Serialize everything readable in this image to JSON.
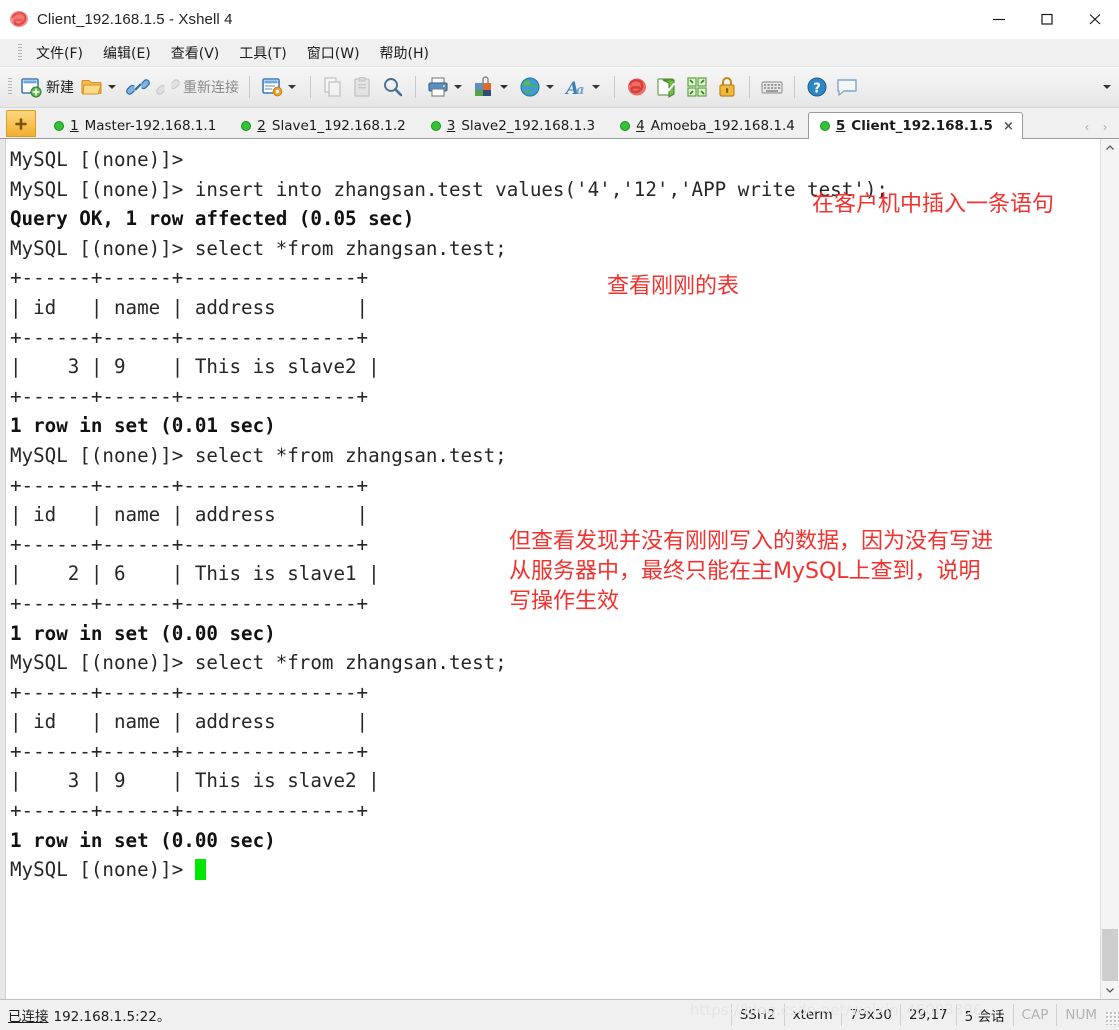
{
  "window": {
    "title": "Client_192.168.1.5 - Xshell 4",
    "app_icon": "xshell-logo-icon",
    "minimize": "—",
    "maximize": "□",
    "close": "✕"
  },
  "menubar": {
    "items": [
      {
        "label": "文件(F)",
        "name": "menu-file"
      },
      {
        "label": "编辑(E)",
        "name": "menu-edit"
      },
      {
        "label": "查看(V)",
        "name": "menu-view"
      },
      {
        "label": "工具(T)",
        "name": "menu-tools"
      },
      {
        "label": "窗口(W)",
        "name": "menu-window"
      },
      {
        "label": "帮助(H)",
        "name": "menu-help"
      }
    ]
  },
  "toolbar": {
    "new_label": "新建",
    "reconnect_label": "重新连接",
    "overflow_label": "▾",
    "icons": [
      "new-session-icon",
      "open-folder-icon",
      "connect-icon",
      "disconnect-icon",
      "session-properties-icon",
      "copy-icon",
      "paste-icon",
      "find-icon",
      "print-icon",
      "color-scheme-icon",
      "globe-icon",
      "font-icon",
      "xftp-icon",
      "transfer-icon",
      "arrange-icon",
      "lock-icon",
      "keyboard-icon",
      "help-icon",
      "comment-icon"
    ]
  },
  "tabs": {
    "new_tab_label": "+",
    "items": [
      {
        "num": "1",
        "label": "Master-192.168.1.1",
        "active": false
      },
      {
        "num": "2",
        "label": "Slave1_192.168.1.2",
        "active": false
      },
      {
        "num": "3",
        "label": "Slave2_192.168.1.3",
        "active": false
      },
      {
        "num": "4",
        "label": "Amoeba_192.168.1.4",
        "active": false
      },
      {
        "num": "5",
        "label": "Client_192.168.1.5",
        "active": true
      }
    ],
    "close_label": "×",
    "prev_label": "‹",
    "next_label": "›"
  },
  "terminal": {
    "lines_before_cursor": "MySQL [(none)]>\nMySQL [(none)]> insert into zhangsan.test values('4','12','APP write test');\n",
    "bold_1": "Query OK, 1 row affected (0.05 sec)",
    "block_1": "\nMySQL [(none)]> select *from zhangsan.test;\n+------+------+---------------+\n| id   | name | address       |\n+------+------+---------------+\n|    3 | 9    | This is slave2 |\n+------+------+---------------+\n",
    "bold_2": "1 row in set (0.01 sec)",
    "block_2": "\nMySQL [(none)]> select *from zhangsan.test;\n+------+------+---------------+\n| id   | name | address       |\n+------+------+---------------+\n|    2 | 6    | This is slave1 |\n+------+------+---------------+\n",
    "bold_3": "1 row in set (0.00 sec)",
    "block_3": "\nMySQL [(none)]> select *from zhangsan.test;\n+------+------+---------------+\n| id   | name | address       |\n+------+------+---------------+\n|    3 | 9    | This is slave2 |\n+------+------+---------------+\n",
    "bold_4": "1 row in set (0.00 sec)",
    "prompt": "\nMySQL [(none)]> ",
    "cursor_color": "#00e700"
  },
  "annotations": {
    "color": "#f2322f",
    "items": [
      {
        "text": "在客户机中插入一条语句"
      },
      {
        "text": "查看刚刚的表"
      },
      {
        "text": "但查看发现并没有刚刚写入的数据，因为没有写进\n从服务器中，最终只能在主MySQL上查到，说明\n写操作生效"
      }
    ]
  },
  "statusbar": {
    "connected_label": "已连接",
    "connected_value": "192.168.1.5:22。",
    "protocol": "SSH2",
    "terminal_type": "xterm",
    "size": "79x30",
    "cursor_pos": "29,17",
    "sessions": "5 会话",
    "caps": "CAP",
    "num": "NUM",
    "watermark": "https://blog.csdn.net/weixin_46003396"
  }
}
